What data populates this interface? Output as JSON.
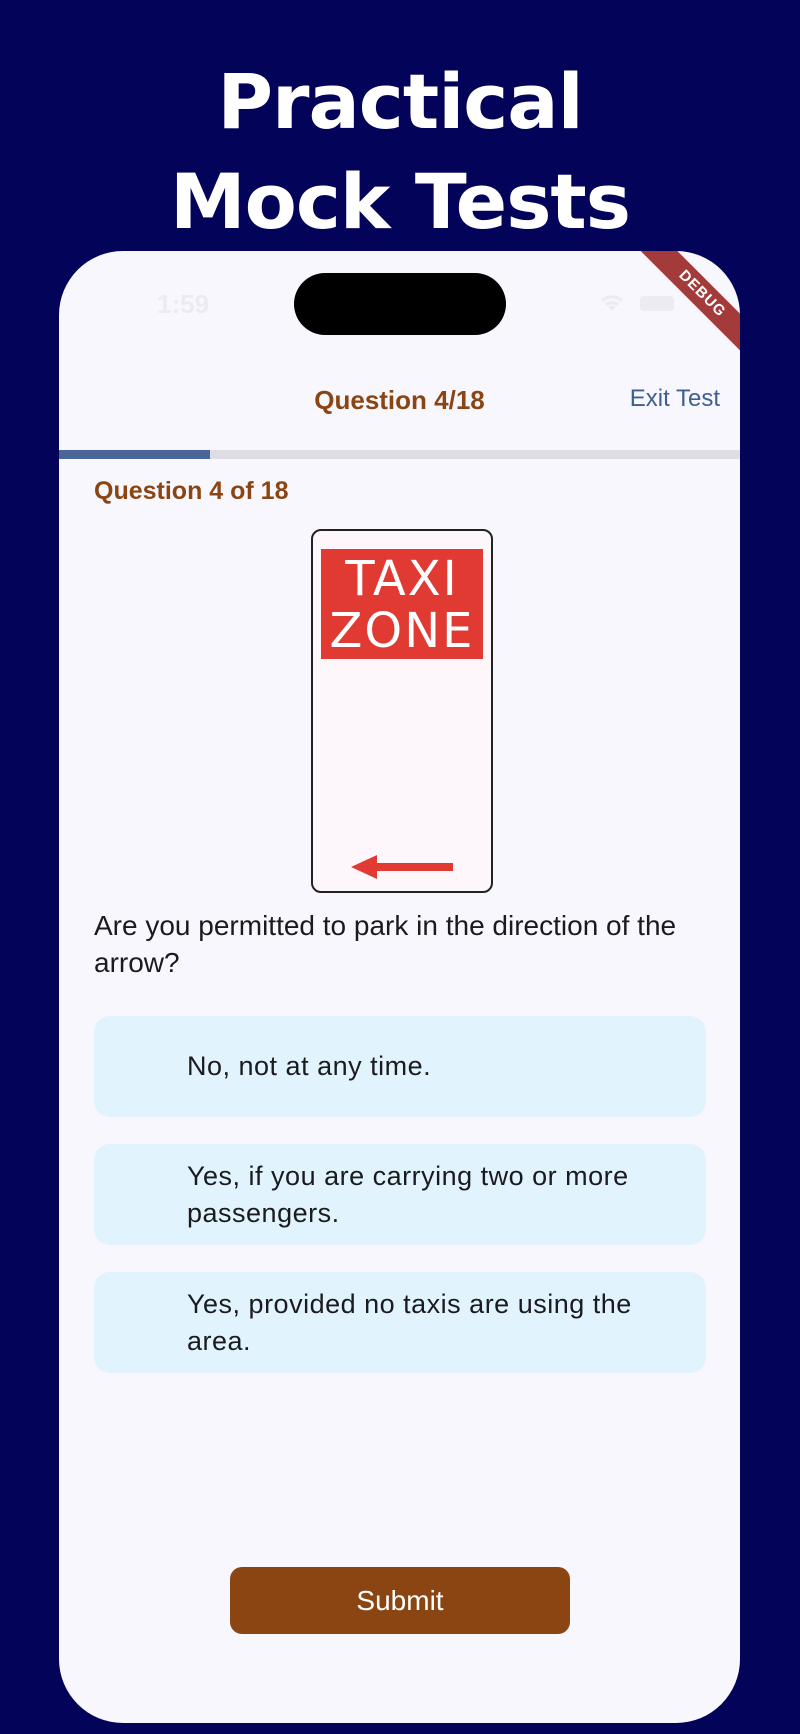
{
  "promo": {
    "headline_line1": "Practical",
    "headline_line2": "Mock Tests"
  },
  "status_bar": {
    "time": "1:59",
    "debug_banner": "DEBUG"
  },
  "app_bar": {
    "title": "Question 4/18",
    "exit_label": "Exit Test"
  },
  "progress": {
    "current": 4,
    "total": 18,
    "fraction": 0.222
  },
  "question": {
    "counter": "Question 4 of 18",
    "sign_line1": "TAXI",
    "sign_line2": "ZONE",
    "sign_arrow_icon": "left-arrow-icon",
    "text": "Are you permitted to park in the direction of the arrow?"
  },
  "options": [
    {
      "label": "No, not at any time."
    },
    {
      "label": "Yes, if you are carrying two or more passengers."
    },
    {
      "label": "Yes, provided no taxis are using the area."
    }
  ],
  "submit_label": "Submit",
  "colors": {
    "background": "#03035a",
    "accent_brown": "#8b4513",
    "progress_blue": "#4a6698",
    "option_bg": "#e1f3fd",
    "sign_red": "#e03a33"
  }
}
